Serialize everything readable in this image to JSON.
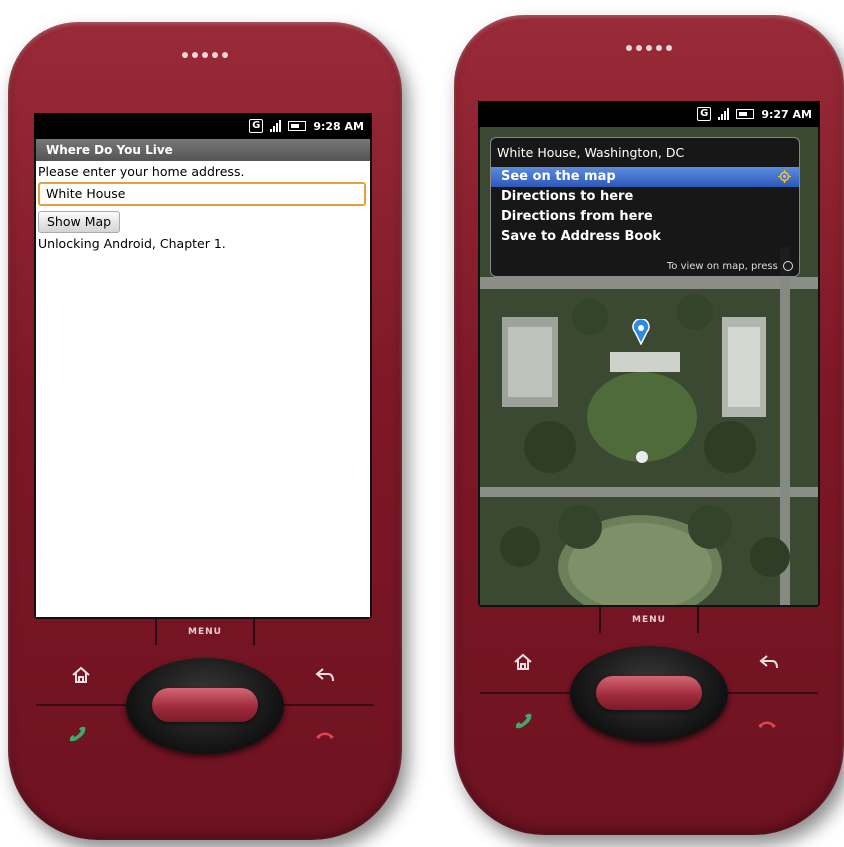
{
  "left_phone": {
    "status": {
      "network": "G",
      "time": "9:28 AM"
    },
    "app_title": "Where Do You Live",
    "prompt": "Please enter your home address.",
    "address_value": "White House",
    "button_label": "Show Map",
    "caption": "Unlocking Android, Chapter 1.",
    "menu_label": "MENU"
  },
  "right_phone": {
    "status": {
      "network": "G",
      "time": "9:27 AM"
    },
    "popup": {
      "title": "White House, Washington, DC",
      "items": [
        {
          "label": "See on the map",
          "selected": true
        },
        {
          "label": "Directions to here",
          "selected": false
        },
        {
          "label": "Directions from here",
          "selected": false
        },
        {
          "label": "Save to Address Book",
          "selected": false
        }
      ],
      "hint": "To view on map, press"
    },
    "menu_label": "MENU"
  },
  "colors": {
    "phone_body": "#7d1827",
    "selection": "#2c58b8",
    "input_focus": "#e6a23a",
    "call_green": "#3fa86a",
    "end_red": "#e04450"
  },
  "icons": [
    "home-icon",
    "back-icon",
    "call-icon",
    "end-call-icon",
    "gps-target-icon",
    "map-pin-icon",
    "signal-icon",
    "battery-icon"
  ]
}
